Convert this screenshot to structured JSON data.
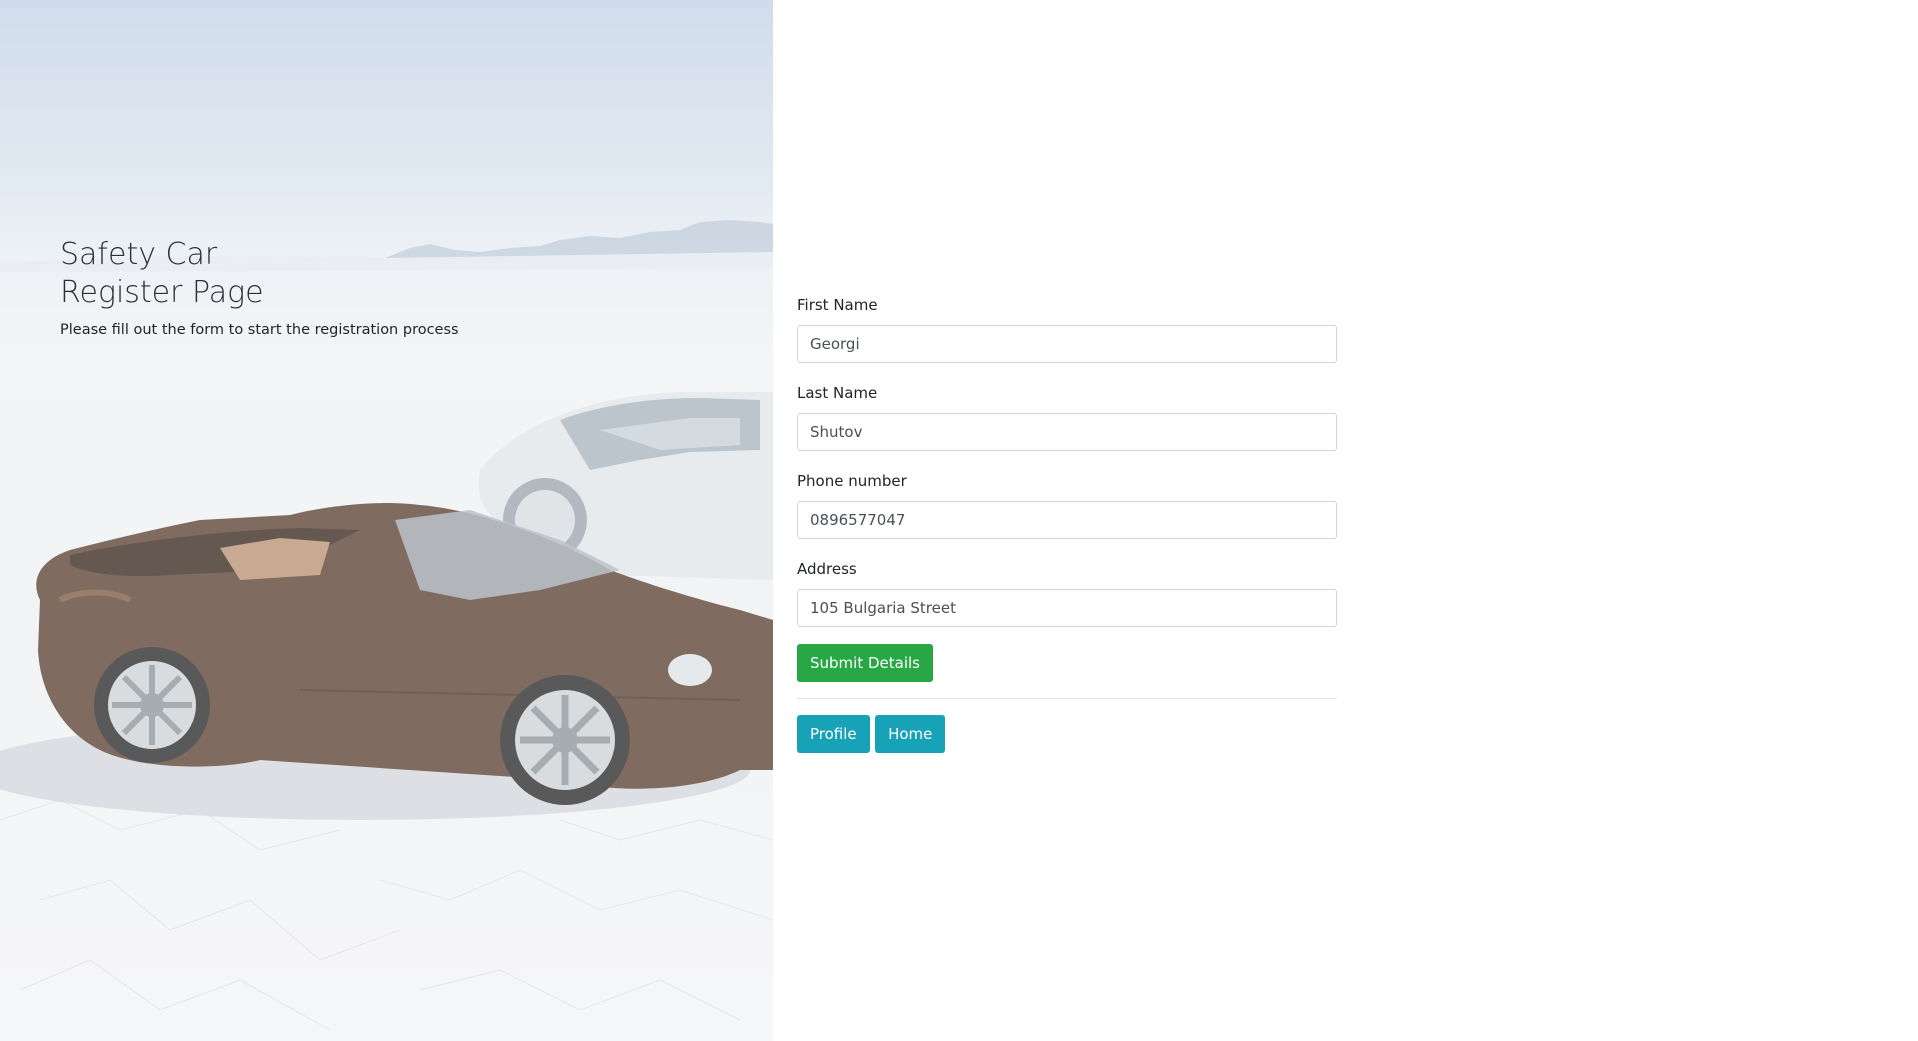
{
  "hero": {
    "title_line1": "Safety Car",
    "title_line2": "Register Page",
    "subtitle": "Please fill out the form to start the registration process"
  },
  "form": {
    "first_name": {
      "label": "First Name",
      "value": "Georgi"
    },
    "last_name": {
      "label": "Last Name",
      "value": "Shutov"
    },
    "phone": {
      "label": "Phone number",
      "value": "0896577047"
    },
    "address": {
      "label": "Address",
      "value": "105 Bulgaria Street"
    },
    "submit_label": "Submit Details"
  },
  "nav": {
    "profile_label": "Profile",
    "home_label": "Home"
  },
  "colors": {
    "success": "#28a745",
    "info": "#17a2b8"
  }
}
